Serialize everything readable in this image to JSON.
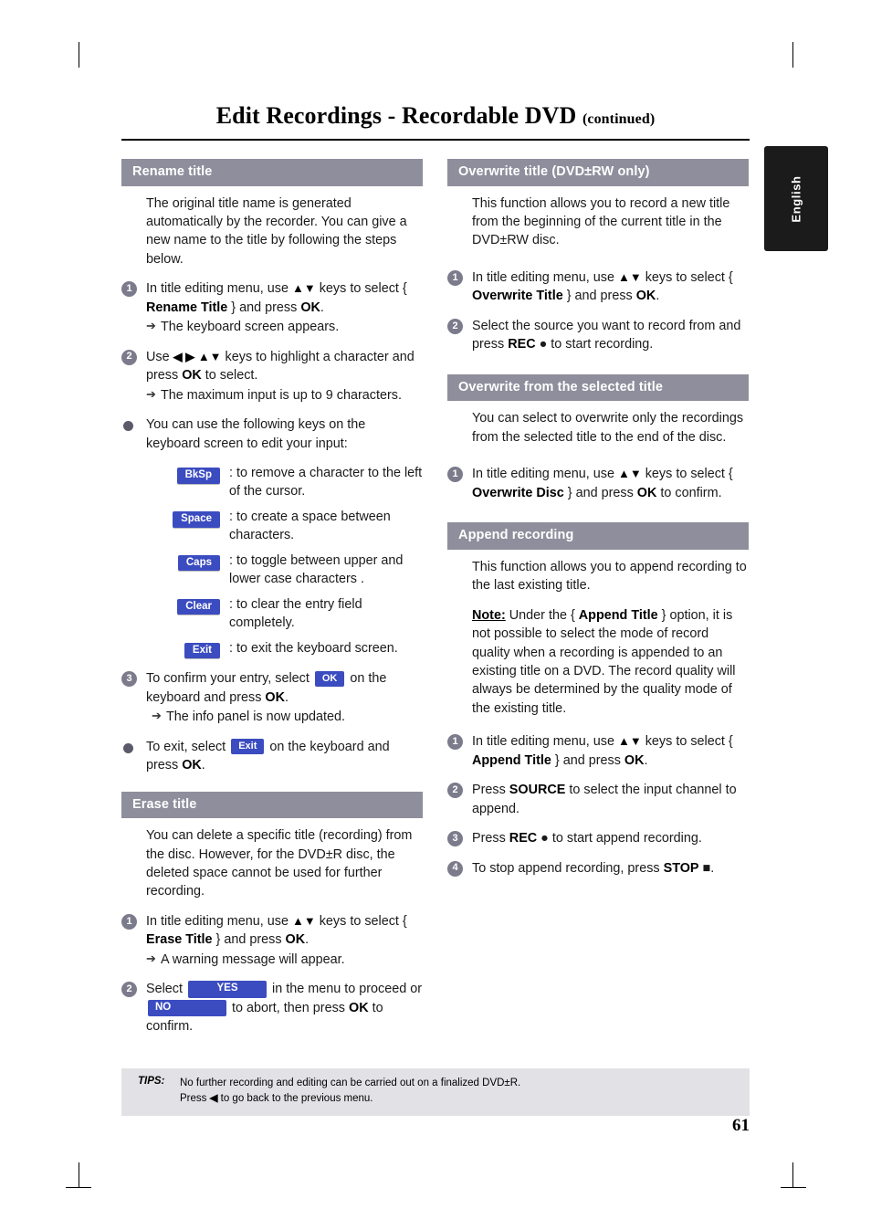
{
  "header": {
    "title": "Edit Recordings - Recordable DVD",
    "title_continued": "(continued)",
    "side_tab": "English"
  },
  "left": {
    "rename": {
      "heading": "Rename title",
      "intro": "The original title name is generated automatically by the recorder. You can give a new name to the title by following the steps below.",
      "step1": {
        "num": "1",
        "text_a": "In title editing menu, use ",
        "keys": "▲▼",
        "text_b": " keys to select { ",
        "bold": "Rename Title",
        "text_c": " } and press ",
        "bold2": "OK",
        "text_d": ".",
        "arrow": "The keyboard screen appears."
      },
      "step2": {
        "num": "2",
        "text_a": "Use ",
        "keys": "◀ ▶ ▲▼",
        "text_b": " keys to highlight a character and press ",
        "bold": "OK",
        "text_c": " to select.",
        "arrow": "The maximum input is up to 9 characters."
      },
      "bullet_keys": "You can use the following keys on the keyboard screen to edit your input:",
      "keys": [
        {
          "chip": "BkSp",
          "desc": ": to remove a character to the left of the cursor."
        },
        {
          "chip": "Space",
          "desc": ": to create a space between characters."
        },
        {
          "chip": "Caps",
          "desc": ": to toggle between upper and lower case characters ."
        },
        {
          "chip": "Clear",
          "desc": ": to clear the entry field completely."
        },
        {
          "chip": "Exit",
          "desc": ": to exit the keyboard screen."
        }
      ],
      "step3": {
        "num": "3",
        "text_a": "To confirm your entry, select ",
        "chip": "OK",
        "text_b": " on the keyboard and press ",
        "bold": "OK",
        "text_c": ".",
        "arrow": "The info panel is now updated."
      },
      "bullet_exit": {
        "text_a": "To exit, select ",
        "chip": "Exit",
        "text_b": " on the keyboard and press ",
        "bold": "OK",
        "text_c": "."
      }
    },
    "erase": {
      "heading": "Erase title",
      "intro": "You can delete a specific title (recording) from the disc. However, for the DVD±R disc, the deleted space cannot be used for further recording.",
      "step1": {
        "num": "1",
        "text_a": "In title editing menu, use ",
        "keys": "▲▼",
        "text_b": " keys to select { ",
        "bold": "Erase Title",
        "text_c": " } and press ",
        "bold2": "OK",
        "text_d": ".",
        "arrow": "A warning message will appear."
      },
      "step2": {
        "num": "2",
        "text_a": "Select ",
        "chip_yes": "YES",
        "text_b": " in the menu to proceed or ",
        "chip_no": "NO",
        "text_c": " to abort, then press ",
        "bold": "OK",
        "text_d": " to confirm."
      }
    }
  },
  "right": {
    "overwrite_title": {
      "heading": "Overwrite title (DVD±RW only)",
      "intro": "This function allows you to record a new title from the beginning of the current title in the DVD±RW disc.",
      "step1": {
        "num": "1",
        "text_a": "In title editing menu, use ",
        "keys": "▲▼",
        "text_b": " keys to select { ",
        "bold": "Overwrite Title",
        "text_c": " } and press ",
        "bold2": "OK",
        "text_d": "."
      },
      "step2": {
        "num": "2",
        "text_a": "Select the source you want to record from and press ",
        "bold": "REC",
        "symbol": " ● ",
        "text_b": "to start recording."
      }
    },
    "overwrite_selected": {
      "heading": "Overwrite from the selected title",
      "intro": "You can select to overwrite only the recordings from the selected title to the end of the disc.",
      "step1": {
        "num": "1",
        "text_a": "In title editing menu, use ",
        "keys": "▲▼",
        "text_b": " keys to select { ",
        "bold": "Overwrite Disc",
        "text_c": " } and press ",
        "bold2": "OK",
        "text_d": " to confirm."
      }
    },
    "append": {
      "heading": "Append recording",
      "intro": "This function allows you to append recording to the last existing title.",
      "note_label": "Note:",
      "note_a": " Under the { ",
      "note_bold": "Append Title",
      "note_b": " } option, it is not possible to select the mode of record quality when a recording is appended to an existing title on a DVD. The record quality will always be determined by the quality mode of the existing title.",
      "step1": {
        "num": "1",
        "text_a": "In title editing menu, use ",
        "keys": "▲▼",
        "text_b": " keys to select { ",
        "bold": "Append Title",
        "text_c": " } and press ",
        "bold2": "OK",
        "text_d": "."
      },
      "step2": {
        "num": "2",
        "text_a": "Press ",
        "bold": "SOURCE",
        "text_b": " to select the input channel to append."
      },
      "step3": {
        "num": "3",
        "text_a": "Press ",
        "bold": "REC",
        "symbol": " ● ",
        "text_b": "to start append recording."
      },
      "step4": {
        "num": "4",
        "text_a": "To stop append recording, press ",
        "bold": "STOP",
        "symbol": " ■",
        "text_b": "."
      }
    }
  },
  "tips": {
    "label": "TIPS:",
    "line1": "No further recording and editing can be carried out on a finalized DVD±R.",
    "line2_a": "Press ",
    "line2_key": "◀",
    "line2_b": " to go back to the previous menu."
  },
  "page_number": "61"
}
